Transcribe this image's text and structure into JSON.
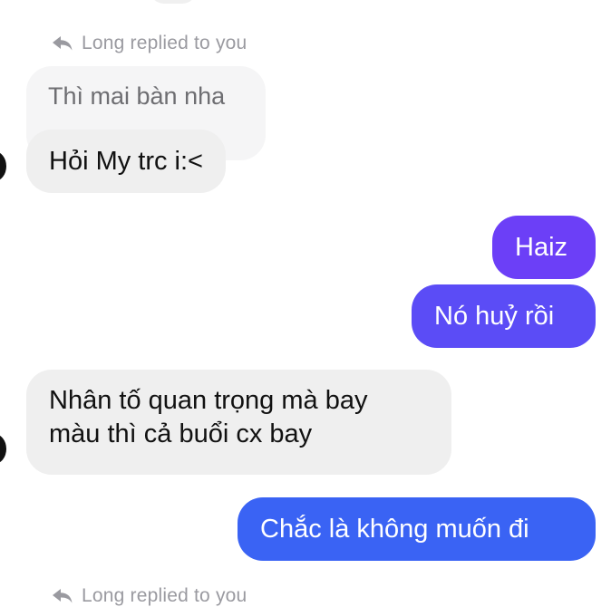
{
  "conversation": {
    "reply_top": {
      "label": "Long replied to you",
      "icon": "reply-arrow-icon"
    },
    "quoted_message": "Thì mai bàn nha",
    "messages": [
      {
        "text": "Hỏi My trc i:<",
        "direction": "incoming"
      },
      {
        "text": "Haiz",
        "direction": "outgoing"
      },
      {
        "text": "Nó huỷ rồi",
        "direction": "outgoing"
      },
      {
        "text": "Nhân tố quan trọng mà bay\nmàu thì cả buổi cx bay",
        "direction": "incoming"
      },
      {
        "text": "Chắc là không muốn đi",
        "direction": "outgoing"
      }
    ],
    "reply_bottom": {
      "label": "Long replied to you",
      "icon": "reply-arrow-icon"
    }
  },
  "colors": {
    "incoming_bg": "#efefef",
    "outgoing_gradient_start": "#7a36f5",
    "outgoing_gradient_end": "#2f67f4",
    "meta_text": "#9a9aa0"
  }
}
